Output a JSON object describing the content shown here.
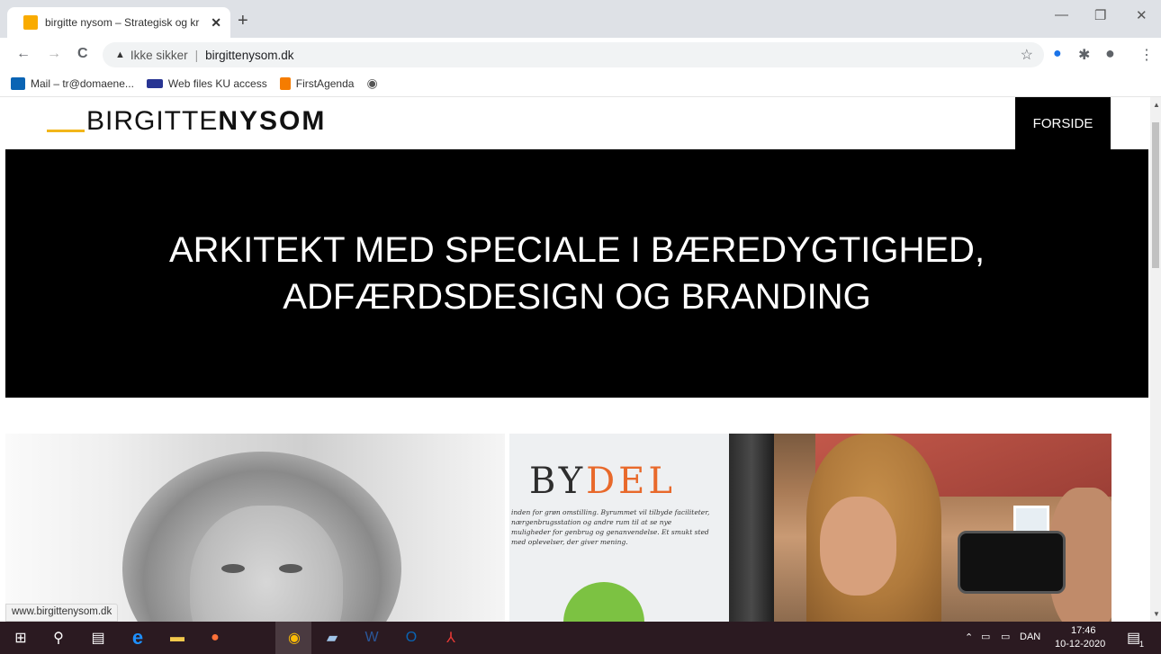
{
  "browser": {
    "tab": {
      "title": "birgitte nysom – Strategisk og kr",
      "close": "✕"
    },
    "new_tab": "+",
    "window_controls": {
      "minimize": "—",
      "restore": "❐",
      "close": "✕"
    },
    "nav": {
      "back": "←",
      "forward": "→",
      "reload": "C"
    },
    "address": {
      "security_label": "Ikke sikker",
      "separator": "|",
      "url": "birgittenysom.dk"
    },
    "bookmarks": [
      {
        "label": "Mail – tr@domaene...",
        "icon": "outlook-icon",
        "color": "#0a64b4"
      },
      {
        "label": "Web files KU access",
        "icon": "http-icon",
        "color": "#283593"
      },
      {
        "label": "FirstAgenda",
        "icon": "bookmark-icon",
        "color": "#f57c00"
      },
      {
        "label": "",
        "icon": "globe-icon",
        "color": "#555555"
      }
    ]
  },
  "site": {
    "logo_light": "BIRGITTE",
    "logo_bold": "NYSOM",
    "nav_forside": "FORSIDE",
    "hero_title": "ARKITEKT MED SPECIALE I BÆREDYGTIGHED, ADFÆRDSDESIGN OG BRANDING",
    "poster_title_1": "BY",
    "poster_title_2": "DEL",
    "poster_text": "inden for grøn omstilling. Byrummet vil tilbyde faciliteter, nærgenbrugsstation og andre rum til at se nye muligheder for genbrug og genanvendelse. Et smukt sted med oplevelser, der giver mening.",
    "status_url": "www.birgittenysom.dk"
  },
  "taskbar": {
    "language": "DAN",
    "time": "17:46",
    "date": "10-12-2020",
    "notification_count": "1"
  },
  "colors": {
    "logo_accent": "#f2b61a",
    "hero_bg": "#000000",
    "taskbar_bg": "#2b1a21"
  }
}
